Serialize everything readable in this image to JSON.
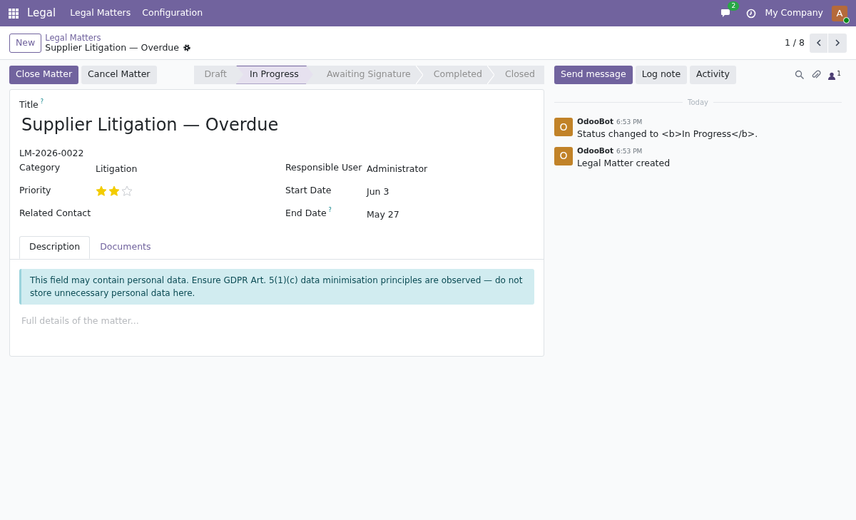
{
  "navbar": {
    "app_name": "Legal",
    "menus": [
      "Legal Matters",
      "Configuration"
    ],
    "messages_count": "2",
    "company": "My Company",
    "avatar_letter": "A",
    "online": true
  },
  "control_panel": {
    "new_button": "New",
    "breadcrumb_parent": "Legal Matters",
    "breadcrumb_current": "Supplier Litigation — Overdue",
    "pager": "1 / 8"
  },
  "actions": [
    {
      "label": "Close Matter",
      "kind": "primary"
    },
    {
      "label": "Cancel Matter",
      "kind": "secondary"
    }
  ],
  "stages": [
    {
      "label": "Draft",
      "selected": false
    },
    {
      "label": "In Progress",
      "selected": true
    },
    {
      "label": "Awaiting Signature",
      "selected": false
    },
    {
      "label": "Completed",
      "selected": false
    },
    {
      "label": "Closed",
      "selected": false
    }
  ],
  "chatter_buttons": [
    {
      "label": "Send message",
      "kind": "primary"
    },
    {
      "label": "Log note",
      "kind": "secondary"
    },
    {
      "label": "Activity",
      "kind": "secondary"
    }
  ],
  "followers_count": "1",
  "form": {
    "title_label": "Title",
    "title_help": "?",
    "title": "Supplier Litigation — Overdue",
    "reference": "LM-2026-0022",
    "left_fields": [
      {
        "label": "Category",
        "kind": "text",
        "value": "Litigation"
      },
      {
        "label": "Priority",
        "kind": "stars",
        "stars": 2
      },
      {
        "label": "Related Contact",
        "kind": "text"
      }
    ],
    "right_fields": [
      {
        "label": "Responsible User",
        "kind": "text",
        "value": "Administrator"
      },
      {
        "label": "Start Date",
        "kind": "text",
        "value": "Jun 3"
      },
      {
        "label": "End Date",
        "help": "?",
        "kind": "text",
        "value": "May 27"
      }
    ],
    "tabs": [
      {
        "label": "Description",
        "selected": true
      },
      {
        "label": "Documents",
        "selected": false
      }
    ],
    "alert": "This field may contain personal data. Ensure GDPR Art. 5(1)(c) data minimisation principles are observed — do not store unnecessary personal data here.",
    "placeholder": "Full details of the matter..."
  },
  "chatter": {
    "date_separator": "Today",
    "messages": [
      {
        "avatar_letter": "O",
        "author": "OdooBot",
        "time": "6:53 PM",
        "body": "Status changed to <b>In Progress</b>."
      },
      {
        "avatar_letter": "O",
        "author": "OdooBot",
        "time": "6:53 PM",
        "body": "Legal Matter created"
      }
    ]
  }
}
